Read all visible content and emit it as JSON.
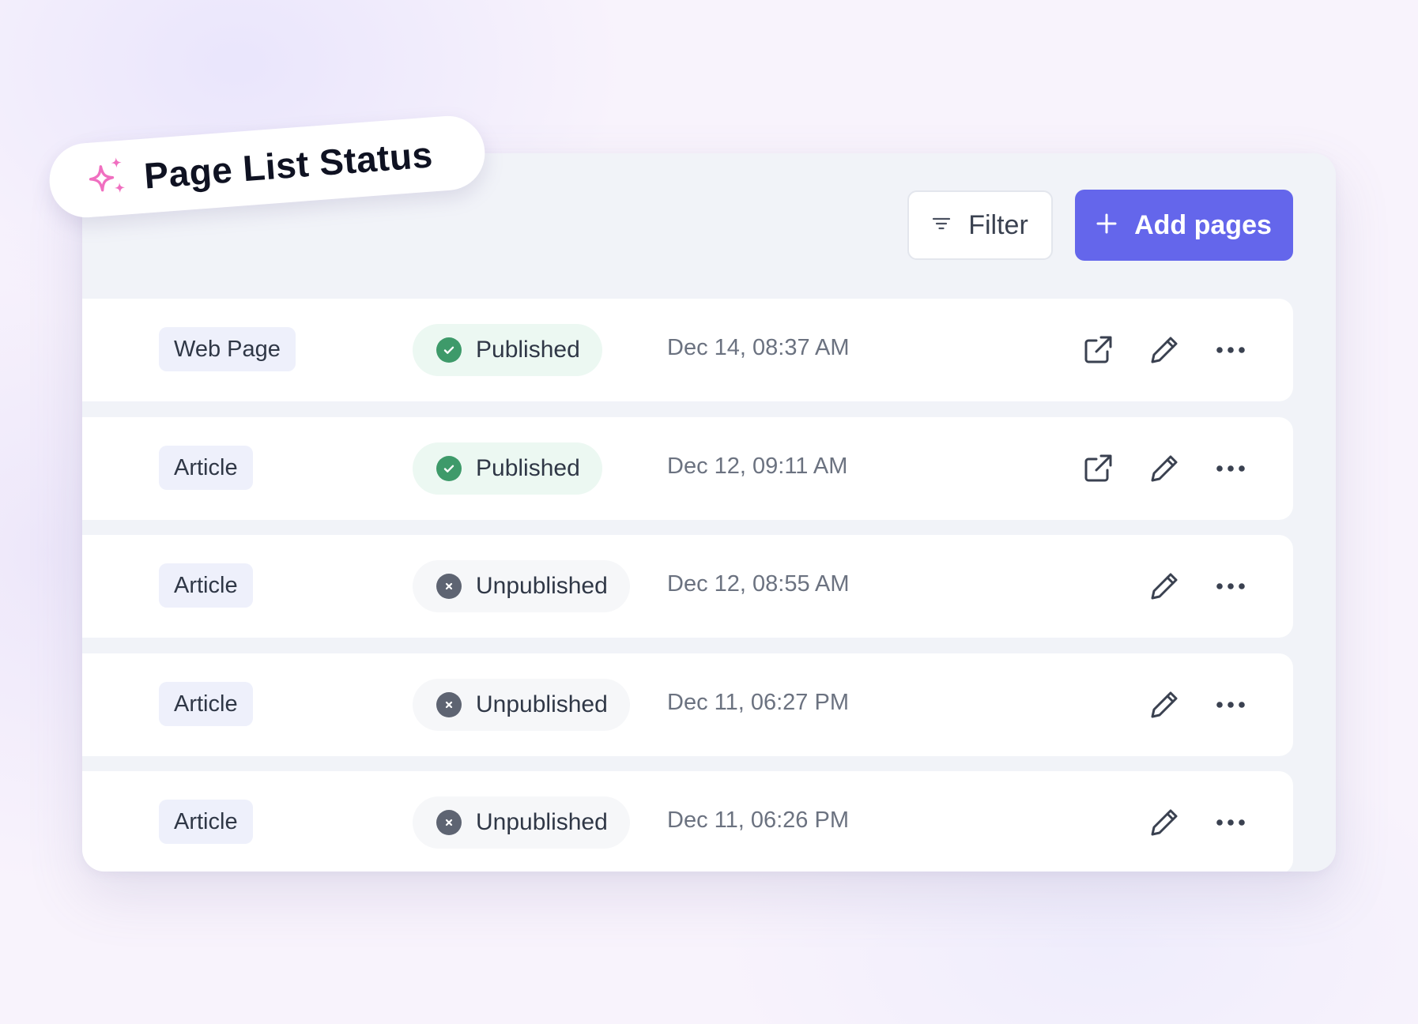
{
  "badge": {
    "title": "Page List Status",
    "icon": "sparkle-icon",
    "icon_color": "#f06fc0"
  },
  "toolbar": {
    "filter_label": "Filter",
    "add_label": "Add pages",
    "accent_color": "#6466eb"
  },
  "rows": [
    {
      "type": "Web Page",
      "status": "Published",
      "date": "Dec 14, 08:37 AM",
      "actions": [
        "open-external-icon",
        "edit-icon",
        "more-icon"
      ]
    },
    {
      "type": "Article",
      "status": "Published",
      "date": "Dec 12, 09:11 AM",
      "actions": [
        "open-external-icon",
        "edit-icon",
        "more-icon"
      ]
    },
    {
      "type": "Article",
      "status": "Unpublished",
      "date": "Dec 12, 08:55 AM",
      "actions": [
        "edit-icon",
        "more-icon"
      ]
    },
    {
      "type": "Article",
      "status": "Unpublished",
      "date": "Dec 11, 06:27 PM",
      "actions": [
        "edit-icon",
        "more-icon"
      ]
    },
    {
      "type": "Article",
      "status": "Unpublished",
      "date": "Dec 11, 06:26 PM",
      "actions": [
        "edit-icon",
        "more-icon"
      ]
    }
  ],
  "status_colors": {
    "published": "#3e9a6a",
    "unpublished": "#5e6472"
  }
}
